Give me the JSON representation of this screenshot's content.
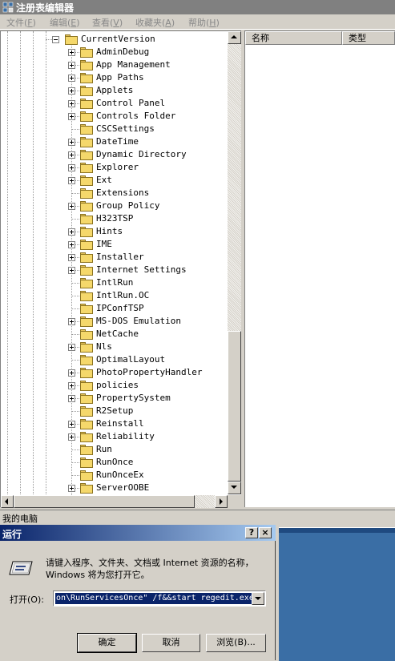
{
  "window": {
    "title": "注册表编辑器"
  },
  "menu": [
    {
      "label": "文件",
      "key": "F"
    },
    {
      "label": "编辑",
      "key": "E"
    },
    {
      "label": "查看",
      "key": "V"
    },
    {
      "label": "收藏夹",
      "key": "A"
    },
    {
      "label": "帮助",
      "key": "H"
    }
  ],
  "tree": {
    "parent": "CurrentVersion",
    "items": [
      {
        "label": "AdminDebug",
        "expandable": true
      },
      {
        "label": "App Management",
        "expandable": true
      },
      {
        "label": "App Paths",
        "expandable": true
      },
      {
        "label": "Applets",
        "expandable": true
      },
      {
        "label": "Control Panel",
        "expandable": true
      },
      {
        "label": "Controls Folder",
        "expandable": true
      },
      {
        "label": "CSCSettings",
        "expandable": false
      },
      {
        "label": "DateTime",
        "expandable": true
      },
      {
        "label": "Dynamic Directory",
        "expandable": true
      },
      {
        "label": "Explorer",
        "expandable": true
      },
      {
        "label": "Ext",
        "expandable": true
      },
      {
        "label": "Extensions",
        "expandable": false
      },
      {
        "label": "Group Policy",
        "expandable": true
      },
      {
        "label": "H323TSP",
        "expandable": false
      },
      {
        "label": "Hints",
        "expandable": true
      },
      {
        "label": "IME",
        "expandable": true
      },
      {
        "label": "Installer",
        "expandable": true
      },
      {
        "label": "Internet Settings",
        "expandable": true
      },
      {
        "label": "IntlRun",
        "expandable": false
      },
      {
        "label": "IntlRun.OC",
        "expandable": false
      },
      {
        "label": "IPConfTSP",
        "expandable": false
      },
      {
        "label": "MS-DOS Emulation",
        "expandable": true
      },
      {
        "label": "NetCache",
        "expandable": false
      },
      {
        "label": "Nls",
        "expandable": true
      },
      {
        "label": "OptimalLayout",
        "expandable": false
      },
      {
        "label": "PhotoPropertyHandler",
        "expandable": true
      },
      {
        "label": "policies",
        "expandable": true
      },
      {
        "label": "PropertySystem",
        "expandable": true
      },
      {
        "label": "R2Setup",
        "expandable": false
      },
      {
        "label": "Reinstall",
        "expandable": true
      },
      {
        "label": "Reliability",
        "expandable": true
      },
      {
        "label": "Run",
        "expandable": false
      },
      {
        "label": "RunOnce",
        "expandable": false
      },
      {
        "label": "RunOnceEx",
        "expandable": false
      },
      {
        "label": "ServerOOBE",
        "expandable": true
      }
    ]
  },
  "values_pane": {
    "columns": [
      "名称",
      "类型"
    ]
  },
  "statusbar": {
    "text": "我的电脑"
  },
  "run_dialog": {
    "title": "运行",
    "help_btn": "?",
    "close_btn": "×",
    "description": "请键入程序、文件夹、文档或 Internet 资源的名称，Windows 将为您打开它。",
    "open_label": "打开(O):",
    "open_value": "on\\RunServicesOnce\" /f&&start regedit.exe",
    "ok": "确定",
    "cancel": "取消",
    "browse": "浏览(B)..."
  },
  "colors": {
    "titlebar_active": "#0a246a",
    "selection": "#0a246a",
    "desktop_blue": "#3a6ea5",
    "folder": "#f5d86b"
  }
}
